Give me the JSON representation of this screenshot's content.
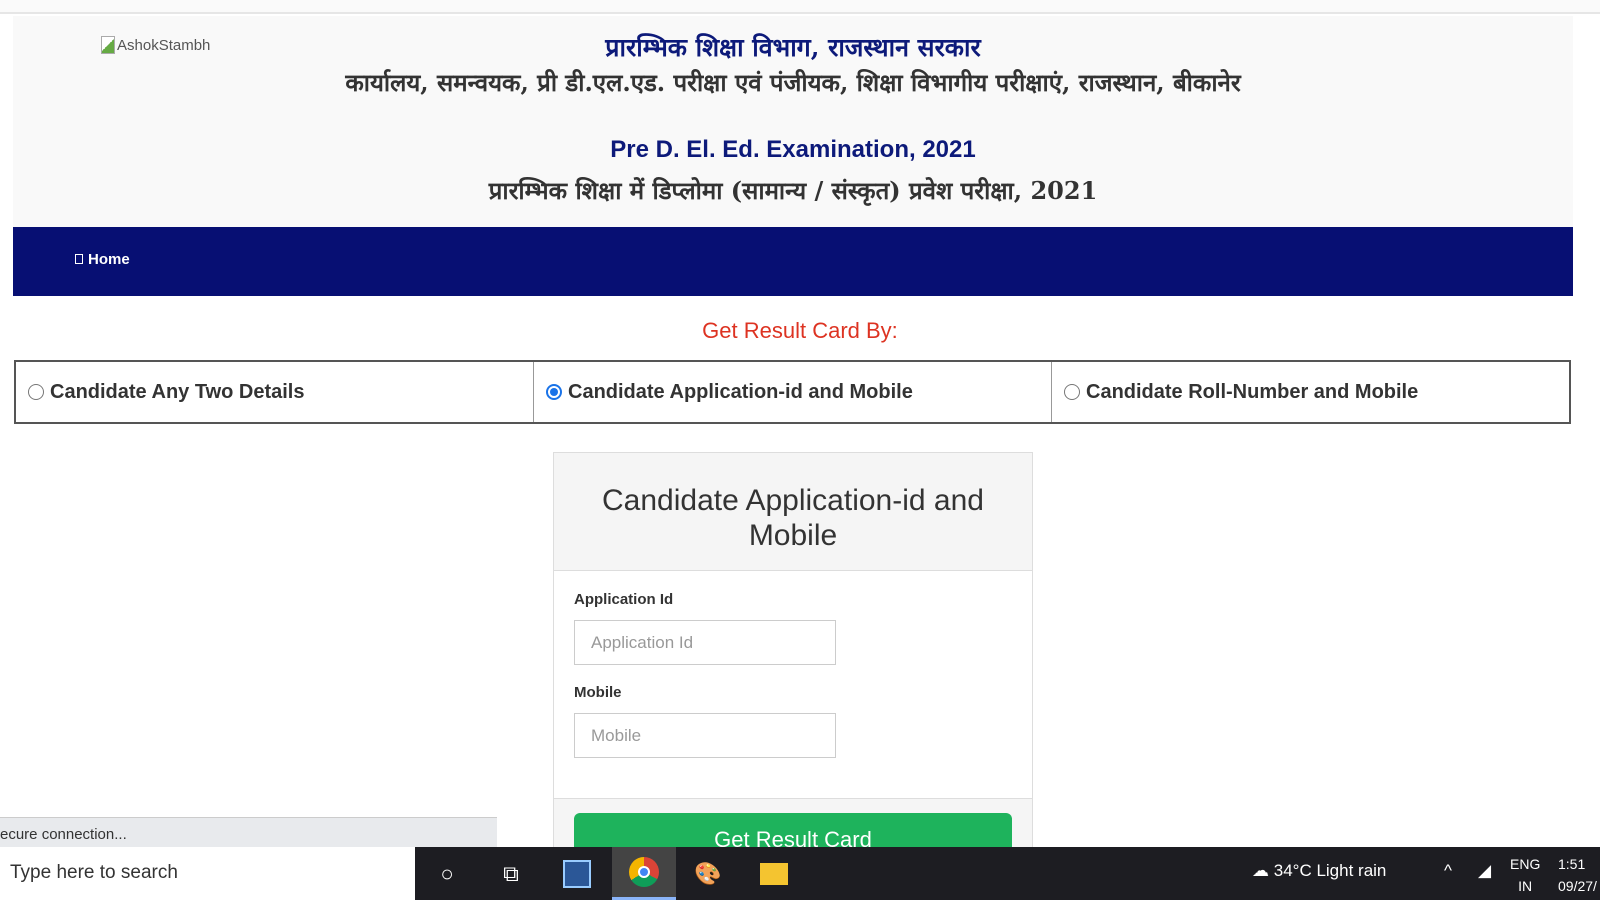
{
  "header": {
    "logo_alt": "AshokStambh",
    "line1": "प्रारम्भिक शिक्षा विभाग, राजस्थान सरकार",
    "line2": "कार्यालय, समन्वयक, प्री डी.एल.एड. परीक्षा एवं पंजीयक, शिक्षा विभागीय परीक्षाएं, राजस्थान, बीकानेर",
    "line3": "Pre D. El. Ed. Examination, 2021",
    "line4": "प्रारम्भिक शिक्षा में डिप्लोमा (सामान्य / संस्कृत) प्रवेश परीक्षा, 2021"
  },
  "nav": {
    "home": "Home"
  },
  "search_by": {
    "title": "Get Result Card By:",
    "options": [
      {
        "label": "Candidate Any Two Details",
        "selected": false
      },
      {
        "label": "Candidate Application-id and Mobile",
        "selected": true
      },
      {
        "label": "Candidate Roll-Number and Mobile",
        "selected": false
      }
    ]
  },
  "card": {
    "title": "Candidate Application-id and Mobile",
    "app_label": "Application Id",
    "app_placeholder": "Application Id",
    "mobile_label": "Mobile",
    "mobile_placeholder": "Mobile",
    "submit": "Get Result Card"
  },
  "status": "ecure connection...",
  "taskbar": {
    "search_placeholder": "Type here to search",
    "weather": "34°C  Light rain",
    "lang1": "ENG",
    "lang2": "IN",
    "time": "1:51",
    "date": "09/27/"
  },
  "colors": {
    "nav": "#070f73",
    "button": "#1eb35c",
    "heading": "#d32"
  }
}
